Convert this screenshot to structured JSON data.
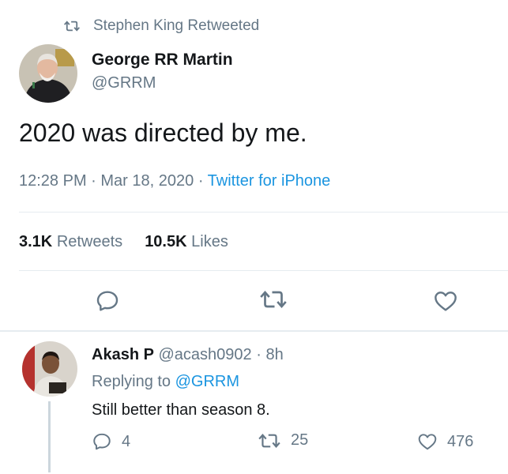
{
  "tweet": {
    "retweet_notice": "Stephen King Retweeted",
    "author_name": "George RR Martin",
    "author_handle": "@GRRM",
    "text": "2020 was directed by me.",
    "time": "12:28 PM",
    "date": "Mar 18, 2020",
    "source": "Twitter for iPhone",
    "retweets_count": "3.1K",
    "retweets_label": "Retweets",
    "likes_count": "10.5K",
    "likes_label": "Likes"
  },
  "reply": {
    "author_name": "Akash P",
    "author_handle": "@acash0902",
    "age": "8h",
    "replying_prefix": "Replying to",
    "replying_to": "@GRRM",
    "text": "Still better than season 8.",
    "reply_count": "4",
    "retweet_count": "25",
    "like_count": "476"
  },
  "colors": {
    "accent": "#1b95e0",
    "muted": "#657786",
    "text": "#14171a",
    "border": "#e6ecf0"
  },
  "icons": [
    "retweet-icon",
    "reply-icon",
    "heart-icon"
  ]
}
